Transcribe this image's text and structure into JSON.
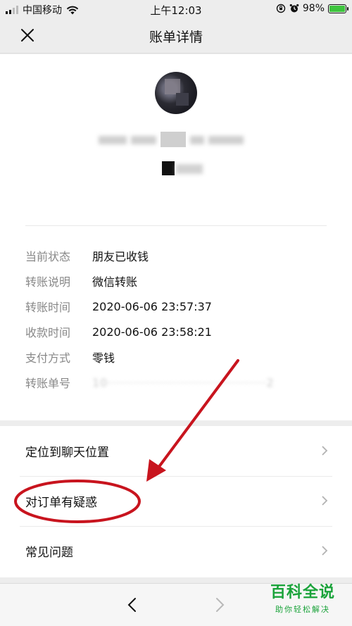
{
  "status_bar": {
    "carrier": "中国移动",
    "time": "上午12:03",
    "battery": "98%"
  },
  "nav": {
    "title": "账单详情",
    "close_icon": "close-icon"
  },
  "details": [
    {
      "label": "当前状态",
      "value": "朋友已收钱"
    },
    {
      "label": "转账说明",
      "value": "微信转账"
    },
    {
      "label": "转账时间",
      "value": "2020-06-06 23:57:37"
    },
    {
      "label": "收款时间",
      "value": "2020-06-06 23:58:21"
    },
    {
      "label": "支付方式",
      "value": "零钱"
    },
    {
      "label": "转账单号",
      "value": "10·····································2"
    }
  ],
  "menu": [
    {
      "label": "定位到聊天位置"
    },
    {
      "label": "对订单有疑惑"
    },
    {
      "label": "常见问题"
    }
  ],
  "watermark": {
    "main": "百科全说",
    "sub": "助你轻松解决"
  },
  "colors": {
    "annotation_red": "#c8141e",
    "watermark_green": "#1aa33a",
    "battery_green": "#3ec43e"
  }
}
